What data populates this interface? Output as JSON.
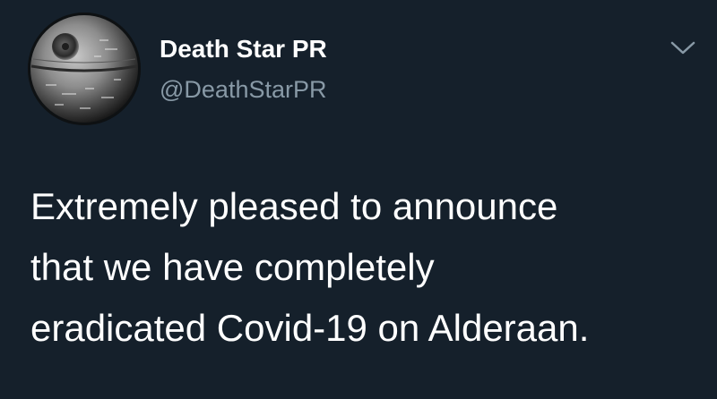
{
  "tweet": {
    "author": {
      "display_name": "Death Star PR",
      "handle": "@DeathStarPR"
    },
    "text_lines": [
      "Extremely pleased to announce",
      "that we have completely",
      "eradicated Covid-19 on Alderaan."
    ],
    "menu_icon": "chevron-down-icon",
    "avatar_icon": "death-star-icon"
  },
  "colors": {
    "background": "#15202b",
    "text": "#ffffff",
    "secondary_text": "#8899a6"
  }
}
